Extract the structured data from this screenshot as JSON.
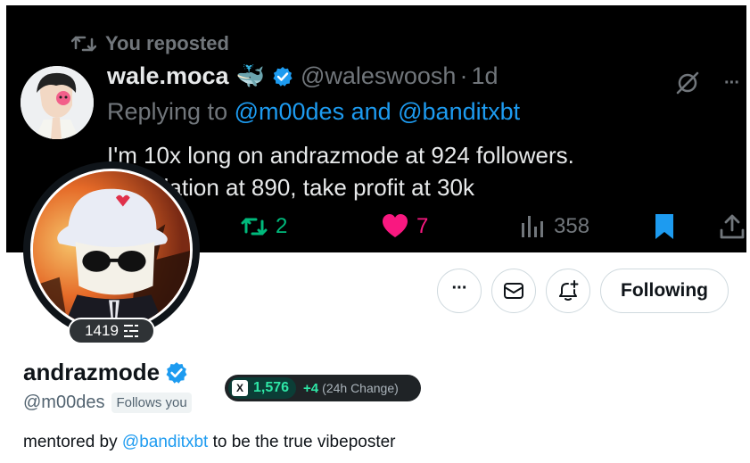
{
  "banner": {
    "repost_label": "You reposted",
    "tweet": {
      "author_name": "wale.moca",
      "author_emoji": "🐳",
      "author_handle": "@waleswoosh",
      "separator": "·",
      "time": "1d",
      "reply_prefix": "Replying to",
      "reply_mentions": "@m00des and @banditxbt",
      "text": "I'm 10x long on andrazmode at 924 followers. Liquidation at 890, take profit at 30k",
      "replies_count": "2",
      "likes_count": "7",
      "views_count": "358",
      "more_label": "···"
    }
  },
  "profile": {
    "level": "1419",
    "display_name": "andrazmode",
    "handle": "@m00des",
    "follows_you": "Follows you",
    "score": "1,576",
    "score_change": "+4",
    "score_change_label": "(24h Change)",
    "score_logo": "X",
    "following_label": "Following",
    "more_label": "···",
    "bio_prefix": "mentored by",
    "bio_mention": "@banditxbt",
    "bio_suffix": "to be the true vibeposter"
  },
  "colors": {
    "accent": "#1d9bf0",
    "like": "#f91880",
    "repost": "#00ba7c",
    "score": "#2ee6a6"
  },
  "icons": [
    "repost-icon",
    "verified-icon",
    "mute-icon",
    "more-icon",
    "retweet-icon",
    "heart-icon",
    "views-icon",
    "bookmark-icon",
    "share-icon",
    "mail-icon",
    "bell-plus-icon",
    "level-icon"
  ]
}
